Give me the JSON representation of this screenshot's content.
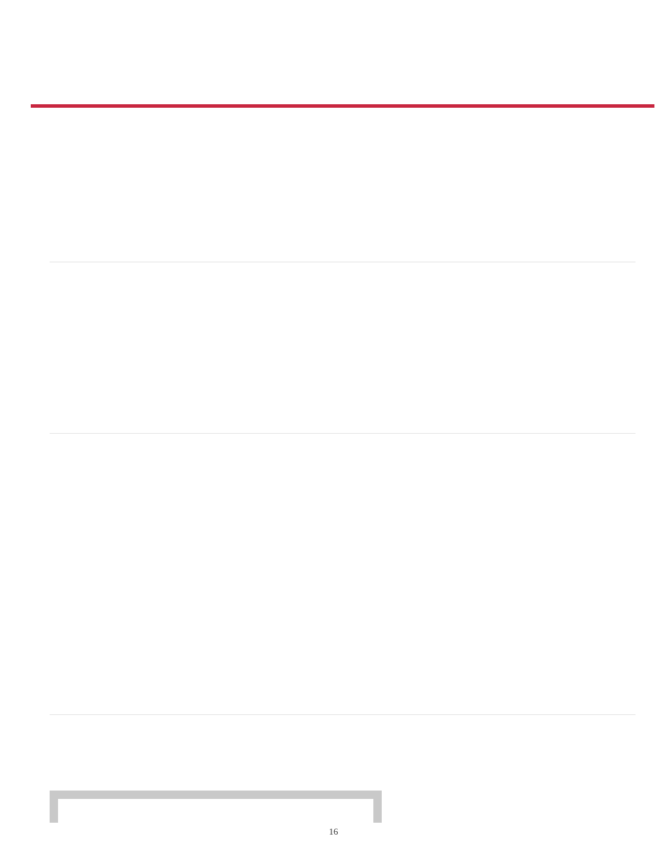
{
  "accent_color": "#c8263f",
  "rule_color": "#e4e4e4",
  "frame_color": "#c9c9c9",
  "page_number": "16"
}
